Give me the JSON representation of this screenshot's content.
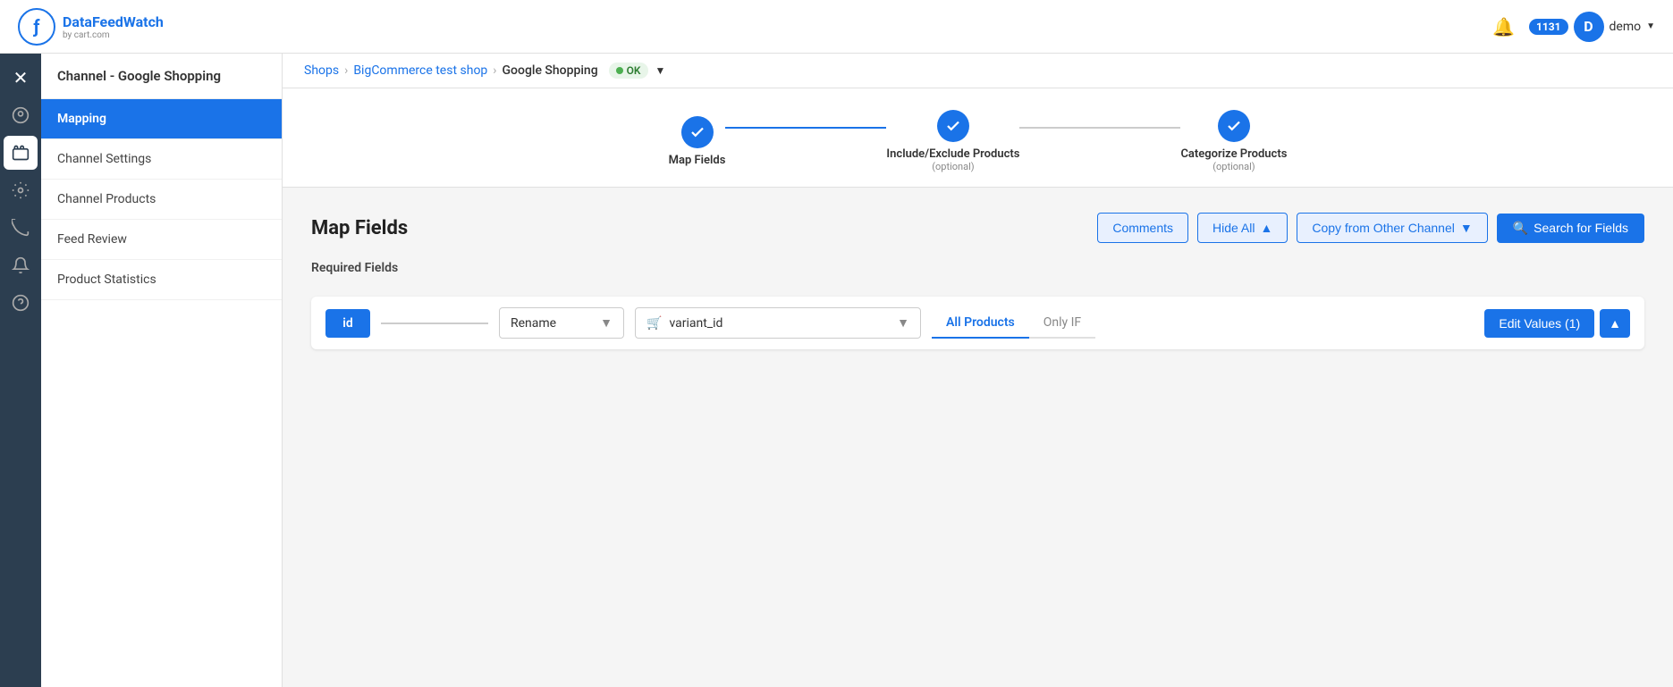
{
  "app": {
    "title": "DataFeedWatch",
    "subtitle": "by cart.com"
  },
  "header": {
    "notification_icon": "🔔",
    "badge_count": "1131",
    "avatar_letter": "D",
    "user_label": "demo",
    "dropdown_arrow": "▼"
  },
  "icon_sidebar": {
    "items": [
      {
        "id": "close",
        "icon": "✕",
        "active": false
      },
      {
        "id": "palette",
        "icon": "🎨",
        "active": false
      },
      {
        "id": "shop",
        "icon": "🏪",
        "active": false
      },
      {
        "id": "settings",
        "icon": "⚙",
        "active": false
      },
      {
        "id": "feeds",
        "icon": "📡",
        "active": false
      },
      {
        "id": "bell",
        "icon": "🔔",
        "active": false
      },
      {
        "id": "help",
        "icon": "?",
        "active": false
      }
    ]
  },
  "channel_panel": {
    "title": "Channel - Google Shopping",
    "nav_items": [
      {
        "id": "mapping",
        "label": "Mapping",
        "active": true
      },
      {
        "id": "channel-settings",
        "label": "Channel Settings",
        "active": false
      },
      {
        "id": "channel-products",
        "label": "Channel Products",
        "active": false
      },
      {
        "id": "feed-review",
        "label": "Feed Review",
        "active": false
      },
      {
        "id": "product-statistics",
        "label": "Product Statistics",
        "active": false
      }
    ]
  },
  "breadcrumb": {
    "shops_label": "Shops",
    "shop_name": "BigCommerce test shop",
    "channel_name": "Google Shopping",
    "status_label": "OK",
    "sep": "›"
  },
  "steps": [
    {
      "id": "map-fields",
      "label": "Map Fields",
      "sublabel": "",
      "completed": true
    },
    {
      "id": "include-exclude",
      "label": "Include/Exclude Products",
      "sublabel": "(optional)",
      "completed": true
    },
    {
      "id": "categorize",
      "label": "Categorize Products",
      "sublabel": "(optional)",
      "completed": true
    }
  ],
  "map_fields": {
    "title": "Map Fields",
    "required_label": "Required Fields",
    "buttons": {
      "comments": "Comments",
      "hide_all": "Hide All",
      "copy_from_other": "Copy from Other Channel",
      "search_for_fields": "Search for Fields"
    },
    "field_rows": [
      {
        "id": "id",
        "rename_label": "Rename",
        "value_label": "variant_id",
        "tab_all": "All Products",
        "tab_only_if": "Only IF",
        "edit_btn": "Edit Values (1)"
      }
    ]
  }
}
